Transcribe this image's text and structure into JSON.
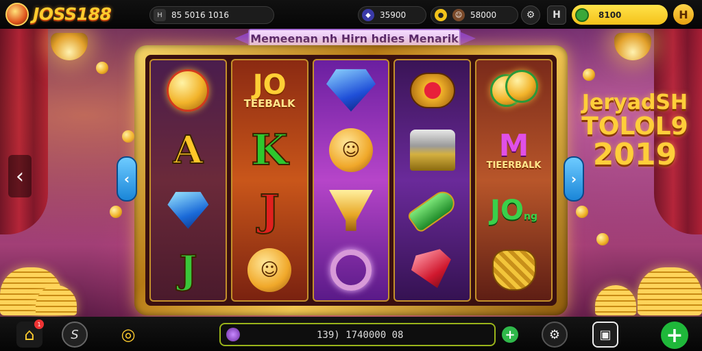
{
  "app": {
    "logo_text": "JOSS188"
  },
  "topbar": {
    "search_pill_icon": "H",
    "search_pill_text": "85 5016 1016",
    "credits_text": "35900",
    "coins_text": "58000",
    "settings_icon": "gear-icon",
    "profile_icon": "H",
    "yellow_pill_text": "8100",
    "help_label": "H"
  },
  "banner": {
    "title": "Memeenan nh Hirn hdies Menarik"
  },
  "reels": [
    [
      "coin",
      "letter-A",
      "gem-blue",
      "letter-J"
    ],
    [
      "word-JO-TEEBALK",
      "letter-K",
      "letter-J",
      "face"
    ],
    [
      "gem-diamond",
      "face",
      "chalice",
      "ring"
    ],
    [
      "amulet",
      "helmet",
      "rocket",
      "red-gem"
    ],
    [
      "coin-stack",
      "word-M-TIEERBALK",
      "word-JO",
      "pot"
    ]
  ],
  "symbols": {
    "reel1_word_big": "JO",
    "reel1_word_small": "TEEBALK",
    "reel4_word_big": "M",
    "reel4_word_small": "TIEERBALK",
    "reel4_jo": "JO",
    "reel4_jo_small": "ng",
    "letter_a": "A",
    "letter_k": "K",
    "letter_j": "J"
  },
  "promo": {
    "line1": "JeryadSH",
    "line2": "TOLOL9",
    "line3": "2019"
  },
  "bottombar": {
    "home_badge": "1",
    "spin_label": "S",
    "balance_text": "139) 1740000 08",
    "plus_label": "+",
    "big_plus_label": "+"
  },
  "colors": {
    "accent_gold": "#ffcc2e",
    "accent_green": "#1fb83a",
    "arrow_blue": "#1a86d8"
  }
}
